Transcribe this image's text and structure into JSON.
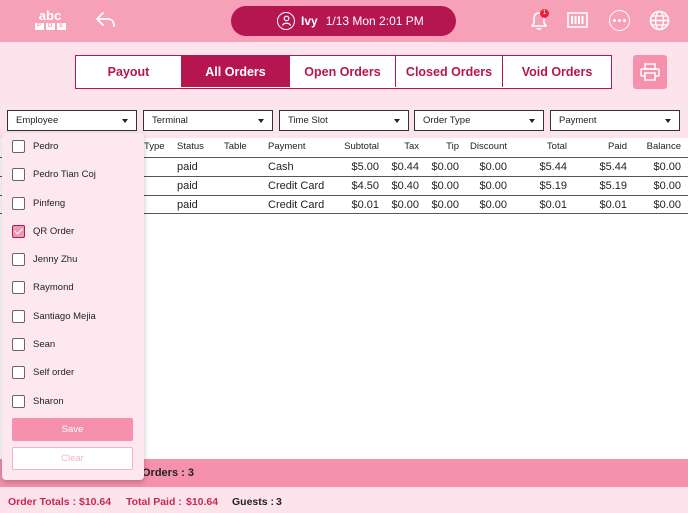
{
  "header": {
    "logo_top": "abc",
    "logo_letters": [
      "P",
      "O",
      "S"
    ],
    "user_name": "Ivy",
    "user_datetime": "1/13 Mon 2:01 PM",
    "notification_count": "1",
    "icons": [
      "back-arrow-icon",
      "user-icon",
      "bell-icon",
      "register-icon",
      "more-icon",
      "globe-icon"
    ]
  },
  "tabs": [
    {
      "label": "Payout",
      "active": false
    },
    {
      "label": "All Orders",
      "active": true
    },
    {
      "label": "Open Orders",
      "active": false
    },
    {
      "label": "Closed Orders",
      "active": false
    },
    {
      "label": "Void Orders",
      "active": false
    }
  ],
  "filters": [
    {
      "label": "Employee"
    },
    {
      "label": "Terminal"
    },
    {
      "label": "Time Slot"
    },
    {
      "label": "Order Type"
    },
    {
      "label": "Payment"
    }
  ],
  "table": {
    "columns": [
      "Type",
      "Status",
      "Table",
      "Payment",
      "Subtotal",
      "Tax",
      "Tip",
      "Discount",
      "Total",
      "Paid",
      "Balance"
    ],
    "rows": [
      {
        "type": "",
        "status": "paid",
        "table": "",
        "payment": "Cash",
        "subtotal": "$5.00",
        "tax": "$0.44",
        "tip": "$0.00",
        "discount": "$0.00",
        "total": "$5.44",
        "paid": "$5.44",
        "balance": "$0.00"
      },
      {
        "type": "",
        "status": "paid",
        "table": "",
        "payment": "Credit Card",
        "subtotal": "$4.50",
        "tax": "$0.40",
        "tip": "$0.00",
        "discount": "$0.00",
        "total": "$5.19",
        "paid": "$5.19",
        "balance": "$0.00"
      },
      {
        "type": "",
        "status": "paid",
        "table": "",
        "payment": "Credit Card",
        "subtotal": "$0.01",
        "tax": "$0.00",
        "tip": "$0.00",
        "discount": "$0.00",
        "total": "$0.01",
        "paid": "$0.01",
        "balance": "$0.00"
      }
    ]
  },
  "employee_dropdown": {
    "items": [
      {
        "label": "Pedro",
        "checked": false
      },
      {
        "label": "Pedro Tian Coj",
        "checked": false
      },
      {
        "label": "Pinfeng",
        "checked": false
      },
      {
        "label": "QR Order",
        "checked": true
      },
      {
        "label": "Jenny Zhu",
        "checked": false
      },
      {
        "label": "Raymond",
        "checked": false
      },
      {
        "label": "Santiago Mejia",
        "checked": false
      },
      {
        "label": "Sean",
        "checked": false
      },
      {
        "label": "Self order",
        "checked": false
      },
      {
        "label": "Sharon",
        "checked": false
      }
    ],
    "save_label": "Save",
    "clear_label": "Clear"
  },
  "footer": {
    "orders_count_text": "Orders :  3",
    "order_totals_label": "Order Totals :",
    "order_totals_value": "$10.64",
    "total_paid_label": "Total Paid :",
    "total_paid_value": "$10.64",
    "guests_label": "Guests :",
    "guests_value": "3"
  },
  "colors": {
    "accent": "#b5164f",
    "topbar": "#f7a1b8",
    "background": "#fde4ec",
    "button_pink": "#f590ad",
    "total_red": "#c8284f"
  }
}
